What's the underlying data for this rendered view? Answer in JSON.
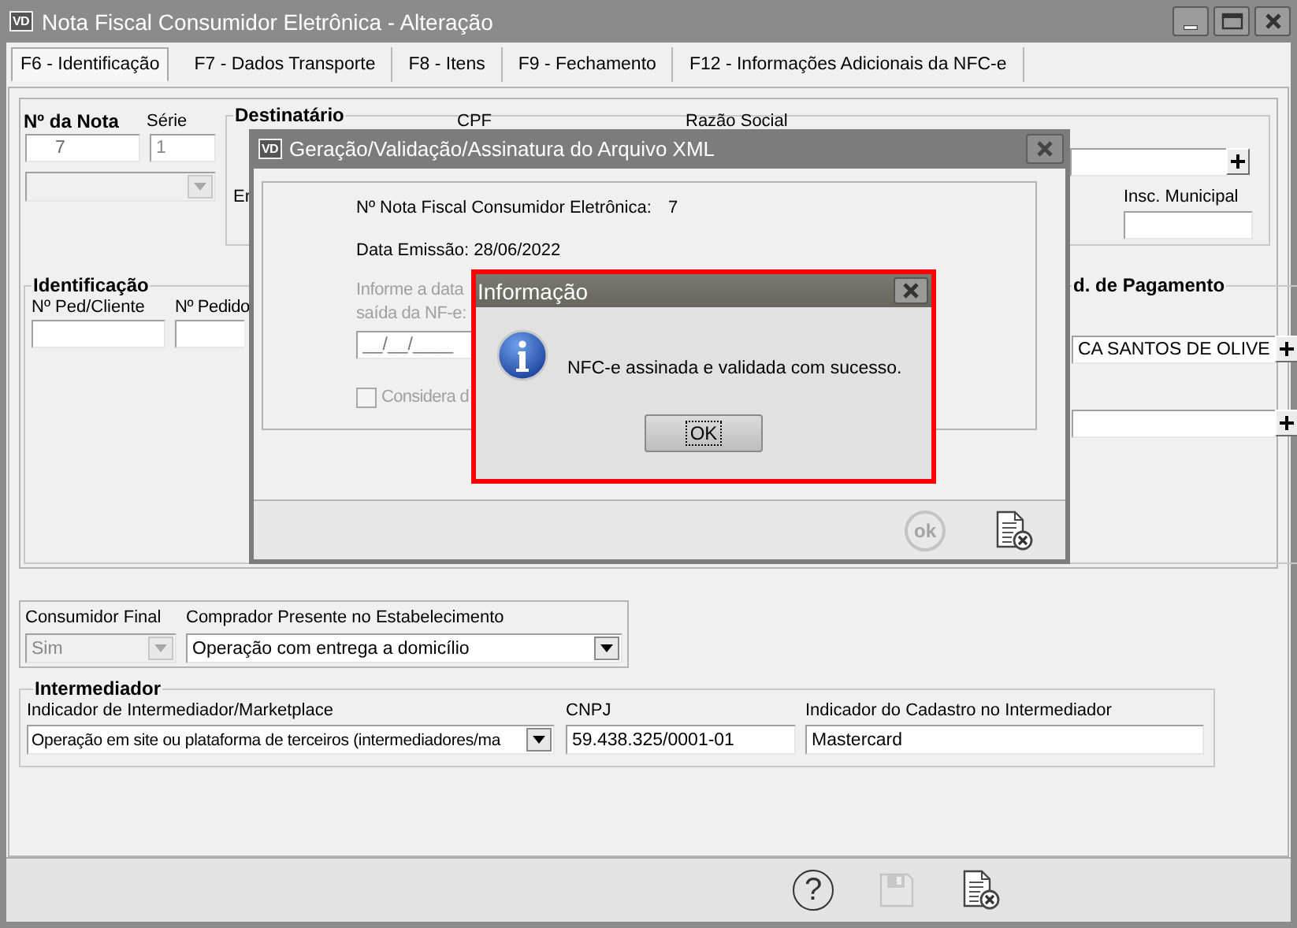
{
  "window": {
    "app_icon": "VD",
    "title": "Nota Fiscal Consumidor Eletrônica - Alteração"
  },
  "tabs": [
    {
      "label": "F6 - Identificação",
      "selected": true
    },
    {
      "label": "F7 - Dados Transporte",
      "selected": false
    },
    {
      "label": "F8 - Itens",
      "selected": false
    },
    {
      "label": "F9 - Fechamento",
      "selected": false
    },
    {
      "label": "F12 - Informações Adicionais da NFC-e",
      "selected": false
    }
  ],
  "nota": {
    "label": "Nº da Nota",
    "value": "7"
  },
  "serie": {
    "label": "Série",
    "value": "1"
  },
  "destinatario": {
    "title": "Destinatário",
    "cpf_label": "CPF",
    "razao_label": "Razão Social",
    "field_label": "Er",
    "insc_label": "Insc. Municipal"
  },
  "identificacao": {
    "title": "Identificação",
    "ped_cliente_label": "Nº Ped/Cliente",
    "pedido_label": "Nº Pedido"
  },
  "pagamento": {
    "title": "d. de Pagamento",
    "field_1": "CA SANTOS DE OLIVE"
  },
  "consumidor": {
    "final_label": "Consumidor Final",
    "final_value": "Sim",
    "final_disabled": true,
    "comprador_label": "Comprador Presente no Estabelecimento",
    "comprador_value": "Operação com entrega a domicílio"
  },
  "intermediador": {
    "title": "Intermediador",
    "indicador_label": "Indicador de Intermediador/Marketplace",
    "indicador_value": "Operação em site ou plataforma de terceiros (intermediadores/ma",
    "cnpj_label": "CNPJ",
    "cnpj_value": "59.438.325/0001-01",
    "cadastro_label": "Indicador do Cadastro no Intermediador",
    "cadastro_value": "Mastercard"
  },
  "toolbar": {
    "help": "?",
    "save_disabled": true
  },
  "xml_dialog": {
    "app_icon": "VD",
    "title": "Geração/Validação/Assinatura do Arquivo XML",
    "nota_label": "Nº Nota Fiscal Consumidor Eletrônica:",
    "nota_value": "7",
    "data_emissao": "Data Emissão: 28/06/2022",
    "informe_line_1": "Informe a data",
    "informe_line_2": "saída da NF-e:",
    "date_placeholder": "__/__/____",
    "checkbox": {
      "label": "Considera d",
      "checked": false,
      "disabled": true
    },
    "ok_label": "ok",
    "ok_disabled": true
  },
  "info_dialog": {
    "title": "Informação",
    "message": "NFC-e assinada e validada com sucesso.",
    "ok": "OK"
  }
}
